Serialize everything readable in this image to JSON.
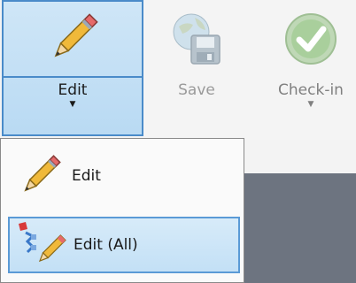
{
  "ribbon": {
    "edit_label": "Edit",
    "save_label": "Save",
    "checkin_label": "Check-in"
  },
  "dropdown": {
    "items": [
      {
        "label": "Edit",
        "icon": "pencil-icon"
      },
      {
        "label": "Edit (All)",
        "icon": "edit-all-icon"
      }
    ]
  },
  "colors": {
    "selection_border": "#4a8bc9",
    "selection_fill": "#c3e0f6",
    "dark_area": "#6d7480"
  }
}
